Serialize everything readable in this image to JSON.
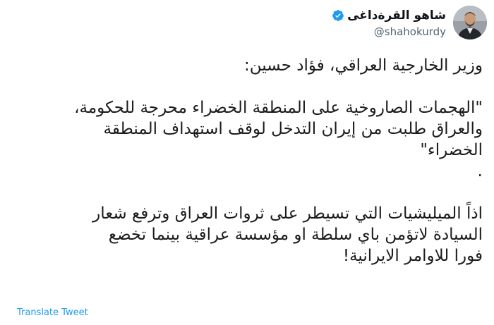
{
  "author": {
    "display_name": "شاهو القرةداغی",
    "handle": "@shahokurdy",
    "verified": true
  },
  "tweet": {
    "lines": [
      "وزير الخارجية العراقي، فؤاد حسين:",
      "",
      "\"الهجمات الصاروخية على المنطقة الخضراء محرجة للحكومة،",
      "والعراق طلبت من إيران التدخل لوقف استهداف المنطقة",
      "الخضراء\"",
      ".",
      "",
      "اذاً الميليشيات التي تسيطر على ثروات العراق وترفع شعار",
      "السيادة لاتؤمن باي سلطة او مؤسسة عراقية بينما تخضع",
      "فورا للاوامر الايرانية!"
    ]
  },
  "actions": {
    "translate_label": "Translate Tweet"
  },
  "colors": {
    "brand": "#1d9bf0",
    "text": "#0f1419",
    "muted": "#536471"
  }
}
